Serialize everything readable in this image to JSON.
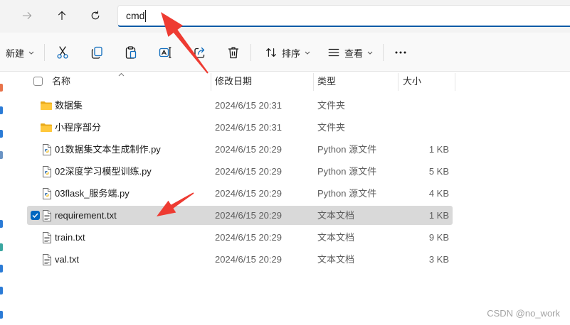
{
  "nav_icons": [
    "forward-icon",
    "up-icon",
    "refresh-icon"
  ],
  "address_bar": {
    "value": "cmd"
  },
  "toolbar": {
    "new_label": "新建",
    "sort_label": "排序",
    "view_label": "查看",
    "icons": [
      "cut-icon",
      "copy-icon",
      "paste-icon",
      "rename-icon",
      "share-icon",
      "delete-icon",
      "more-options-icon"
    ]
  },
  "columns": {
    "name": "名称",
    "modified": "修改日期",
    "type": "类型",
    "size": "大小"
  },
  "files": [
    {
      "name": "数据集",
      "modified": "2024/6/15 20:31",
      "type": "文件夹",
      "icon": "folder-icon"
    },
    {
      "name": "小程序部分",
      "modified": "2024/6/15 20:31",
      "type": "文件夹",
      "icon": "folder-icon"
    },
    {
      "name": "01数据集文本生成制作.py",
      "modified": "2024/6/15 20:29",
      "type": "Python 源文件",
      "size": "1 KB",
      "icon": "python-file-icon"
    },
    {
      "name": "02深度学习模型训练.py",
      "modified": "2024/6/15 20:29",
      "type": "Python 源文件",
      "size": "5 KB",
      "icon": "python-file-icon"
    },
    {
      "name": "03flask_服务端.py",
      "modified": "2024/6/15 20:29",
      "type": "Python 源文件",
      "size": "4 KB",
      "icon": "python-file-icon"
    },
    {
      "name": "requirement.txt",
      "modified": "2024/6/15 20:29",
      "type": "文本文档",
      "size": "1 KB",
      "icon": "text-file-icon",
      "selected": true
    },
    {
      "name": "train.txt",
      "modified": "2024/6/15 20:29",
      "type": "文本文档",
      "size": "9 KB",
      "icon": "text-file-icon"
    },
    {
      "name": "val.txt",
      "modified": "2024/6/15 20:29",
      "type": "文本文档",
      "size": "3 KB",
      "icon": "text-file-icon"
    }
  ],
  "watermark": "CSDN @no_work",
  "colors": {
    "accent": "#0067c0",
    "selected_row": "#d9d9d9",
    "annotation": "#ee3b32",
    "folder": "#ffc83d"
  }
}
